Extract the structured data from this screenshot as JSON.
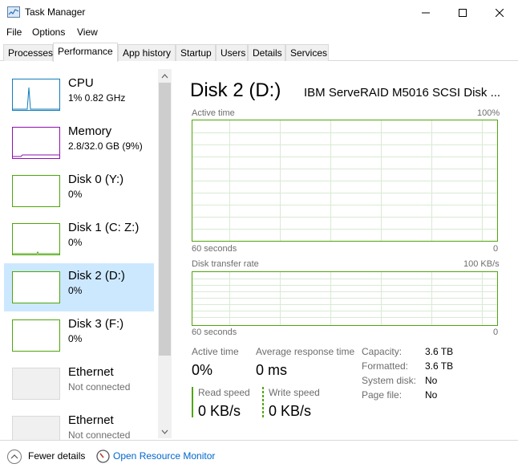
{
  "window": {
    "title": "Task Manager"
  },
  "menu": {
    "file": "File",
    "options": "Options",
    "view": "View"
  },
  "tabs": [
    "Processes",
    "Performance",
    "App history",
    "Startup",
    "Users",
    "Details",
    "Services"
  ],
  "sidebar": {
    "items": [
      {
        "title": "CPU",
        "sub": "1%  0.82 GHz",
        "color": "#117dbb"
      },
      {
        "title": "Memory",
        "sub": "2.8/32.0 GB (9%)",
        "color": "#8b12ae"
      },
      {
        "title": "Disk 0 (Y:)",
        "sub": "0%",
        "color": "#4da60c"
      },
      {
        "title": "Disk 1 (C: Z:)",
        "sub": "0%",
        "color": "#4da60c"
      },
      {
        "title": "Disk 2 (D:)",
        "sub": "0%",
        "color": "#4da60c"
      },
      {
        "title": "Disk 3 (F:)",
        "sub": "0%",
        "color": "#4da60c"
      },
      {
        "title": "Ethernet",
        "sub": "Not connected",
        "color": "#d9d9d9"
      },
      {
        "title": "Ethernet",
        "sub": "Not connected",
        "color": "#d9d9d9"
      }
    ]
  },
  "main": {
    "title": "Disk 2 (D:)",
    "model": "IBM ServeRAID M5016 SCSI Disk ...",
    "active_time_graph": {
      "label": "Active time",
      "max": "100%",
      "xlabel": "60 seconds",
      "min": "0"
    },
    "transfer_graph": {
      "label": "Disk transfer rate",
      "max": "100 KB/s",
      "xlabel": "60 seconds",
      "min": "0"
    },
    "stats": {
      "active_time_label": "Active time",
      "active_time_value": "0%",
      "avg_response_label": "Average response time",
      "avg_response_value": "0 ms",
      "read_label": "Read speed",
      "read_value": "0 KB/s",
      "write_label": "Write speed",
      "write_value": "0 KB/s"
    },
    "properties": [
      {
        "label": "Capacity:",
        "value": "3.6 TB"
      },
      {
        "label": "Formatted:",
        "value": "3.6 TB"
      },
      {
        "label": "System disk:",
        "value": "No"
      },
      {
        "label": "Page file:",
        "value": "No"
      }
    ]
  },
  "footer": {
    "fewer_details": "Fewer details",
    "resource_monitor": "Open Resource Monitor"
  },
  "colors": {
    "disk": "#4da60c",
    "selected": "#cce8ff",
    "link": "#0066cc"
  }
}
